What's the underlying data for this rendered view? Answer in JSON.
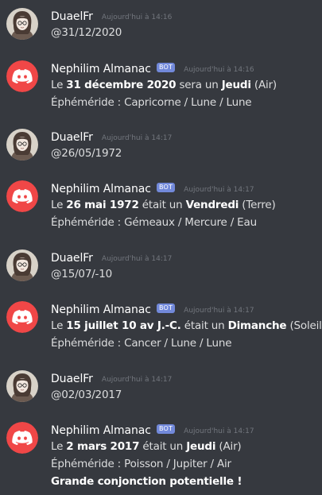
{
  "users": {
    "human": {
      "name": "DuaelFr"
    },
    "bot": {
      "name": "Nephilim Almanac",
      "tag": "BOT"
    }
  },
  "colors": {
    "background": "#36393f",
    "bot_avatar": "#f04747",
    "bot_tag": "#7289da"
  },
  "messages": [
    {
      "author": "DuaelFr",
      "timestamp": "Aujourd'hui à 14:16",
      "text": "@31/12/2020"
    },
    {
      "author": "Nephilim Almanac",
      "tag": "BOT",
      "timestamp": "Aujourd'hui à 14:16",
      "line1": {
        "pre": "Le ",
        "date": "31 décembre 2020",
        "mid": " sera un ",
        "day": "Jeudi",
        "post": " (Air)"
      },
      "line2": "Éphéméride : Capricorne / Lune / Lune"
    },
    {
      "author": "DuaelFr",
      "timestamp": "Aujourd'hui à 14:17",
      "text": "@26/05/1972"
    },
    {
      "author": "Nephilim Almanac",
      "tag": "BOT",
      "timestamp": "Aujourd'hui à 14:17",
      "line1": {
        "pre": "Le ",
        "date": "26 mai 1972",
        "mid": " était un ",
        "day": "Vendredi",
        "post": " (Terre)"
      },
      "line2": "Éphéméride : Gémeaux / Mercure / Eau"
    },
    {
      "author": "DuaelFr",
      "timestamp": "Aujourd'hui à 14:17",
      "text": "@15/07/-10"
    },
    {
      "author": "Nephilim Almanac",
      "tag": "BOT",
      "timestamp": "Aujourd'hui à 14:17",
      "line1": {
        "pre": "Le ",
        "date": "15 juillet 10 av J.-C.",
        "mid": " était un ",
        "day": "Dimanche",
        "post": " (Soleil)"
      },
      "line2": "Éphéméride : Cancer / Lune / Lune"
    },
    {
      "author": "DuaelFr",
      "timestamp": "Aujourd'hui à 14:17",
      "text": "@02/03/2017"
    },
    {
      "author": "Nephilim Almanac",
      "tag": "BOT",
      "timestamp": "Aujourd'hui à 14:17",
      "line1": {
        "pre": "Le ",
        "date": "2 mars 2017",
        "mid": " était un ",
        "day": "Jeudi",
        "post": " (Air)"
      },
      "line2": "Éphéméride : Poisson / Jupiter / Air",
      "line3": "Grande conjonction potentielle !"
    }
  ]
}
